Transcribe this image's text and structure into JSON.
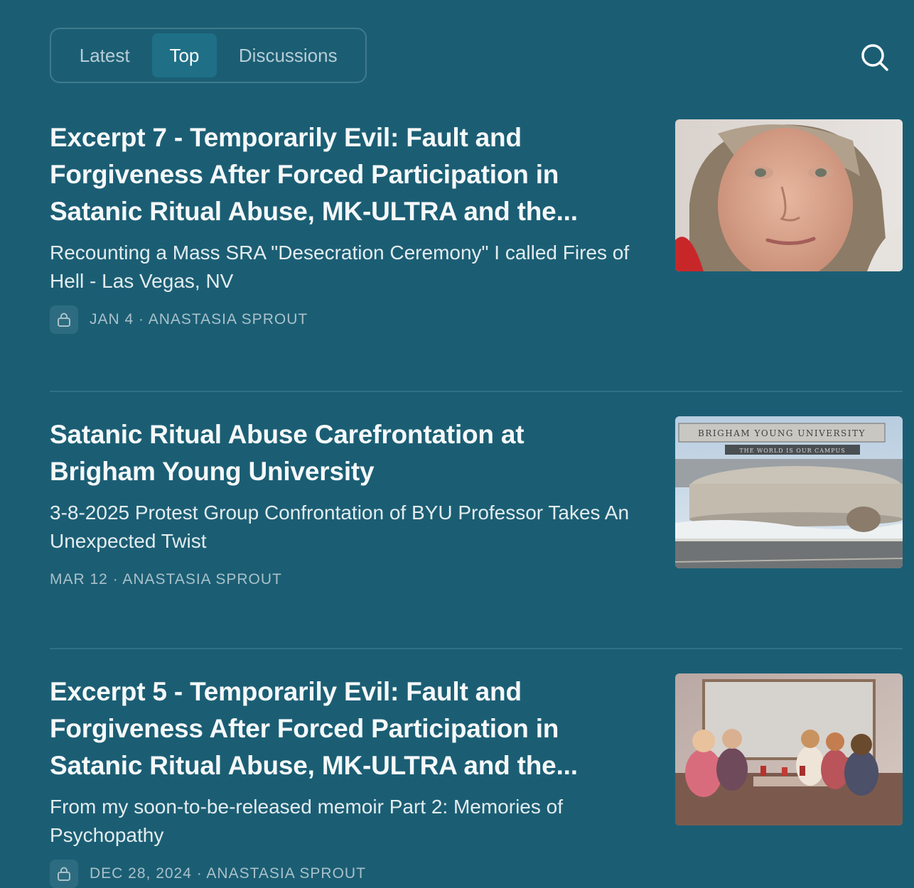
{
  "tabs": {
    "latest": "Latest",
    "top": "Top",
    "discussions": "Discussions",
    "active": "Top"
  },
  "search": {
    "icon": "search-icon"
  },
  "posts": [
    {
      "title": "Excerpt 7 - Temporarily Evil: Fault and Forgiveness After Forced Participation in Satanic Ritual Abuse, MK-ULTRA and the...",
      "subtitle": "Recounting a Mass SRA \"Desecration Ceremony\" I called Fires of Hell - Las Vegas, NV",
      "meta": "JAN 4 · ANASTASIA SPROUT",
      "locked": true
    },
    {
      "title": "Satanic Ritual Abuse Carefrontation at Brigham Young University",
      "subtitle": "3-8-2025 Protest Group Confrontation of BYU Professor Takes An Unexpected Twist",
      "meta": "MAR 12 · ANASTASIA SPROUT",
      "locked": false,
      "thumb": {
        "sign_line1": "BRIGHAM YOUNG UNIVERSITY",
        "sign_line2": "THE WORLD IS OUR CAMPUS"
      }
    },
    {
      "title": "Excerpt 5 - Temporarily Evil: Fault and Forgiveness After Forced Participation in Satanic Ritual Abuse, MK-ULTRA and the...",
      "subtitle": "From my soon-to-be-released memoir Part 2: Memories of Psychopathy",
      "meta": "DEC 28, 2024 · ANASTASIA SPROUT",
      "locked": true
    }
  ],
  "colors": {
    "background": "#1b5e74",
    "active_tab": "#1f6f87",
    "muted": "#a9c1ca"
  }
}
